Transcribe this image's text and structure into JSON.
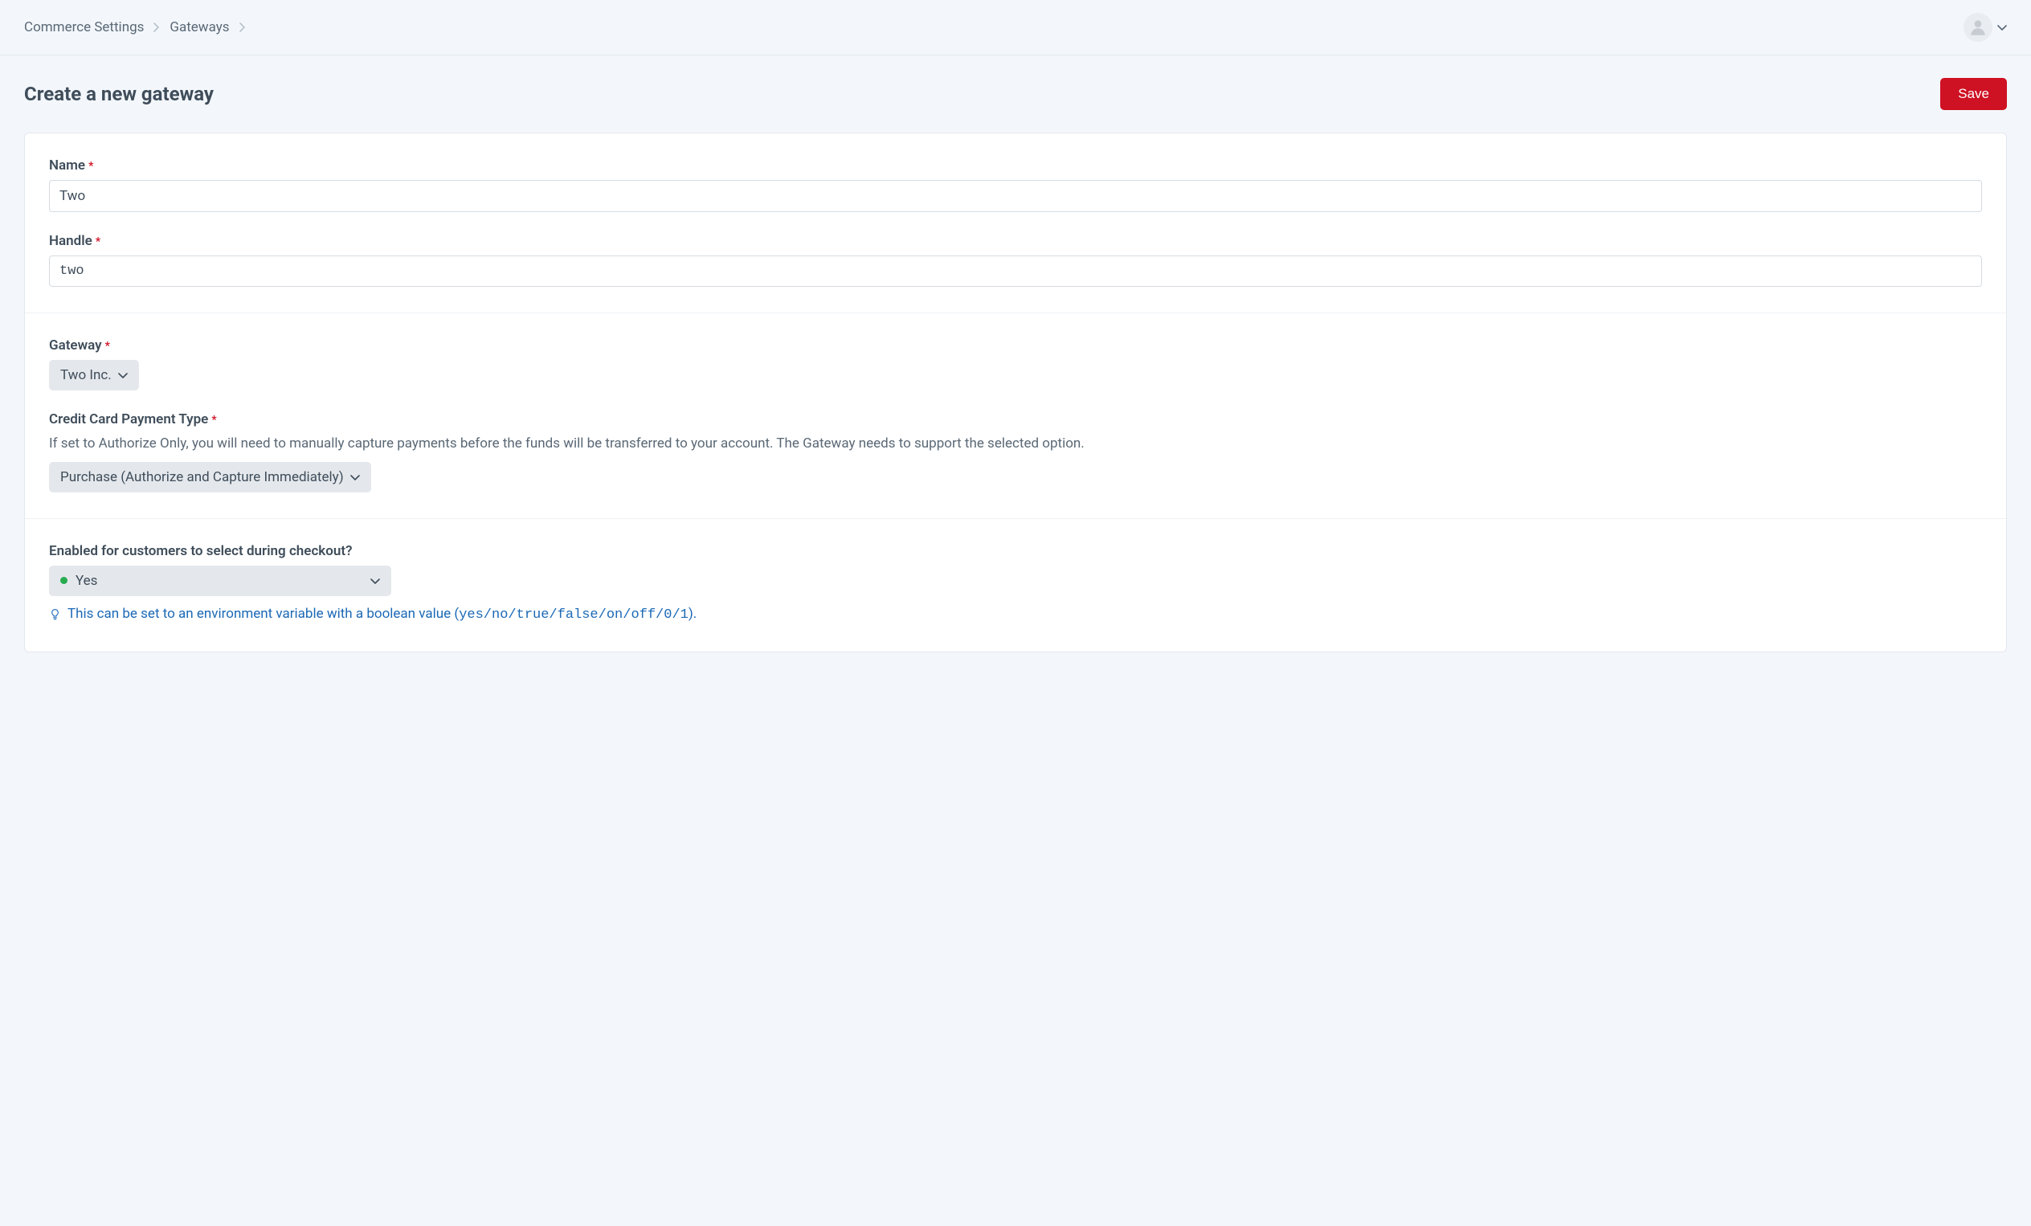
{
  "breadcrumb": {
    "items": [
      {
        "label": "Commerce Settings"
      },
      {
        "label": "Gateways"
      }
    ]
  },
  "page": {
    "title": "Create a new gateway",
    "save_label": "Save"
  },
  "fields": {
    "name": {
      "label": "Name",
      "value": "Two"
    },
    "handle": {
      "label": "Handle",
      "value": "two"
    },
    "gateway": {
      "label": "Gateway",
      "selected": "Two Inc."
    },
    "paymentType": {
      "label": "Credit Card Payment Type",
      "help": "If set to Authorize Only, you will need to manually capture payments before the funds will be transferred to your account. The Gateway needs to support the selected option.",
      "selected": "Purchase (Authorize and Capture Immediately)"
    },
    "enabled": {
      "label": "Enabled for customers to select during checkout?",
      "selected": "Yes",
      "tip_prefix": "This can be set to an environment variable with a boolean value (",
      "tip_code": "yes/no/true/false/on/off/0/1",
      "tip_suffix": ")."
    }
  }
}
